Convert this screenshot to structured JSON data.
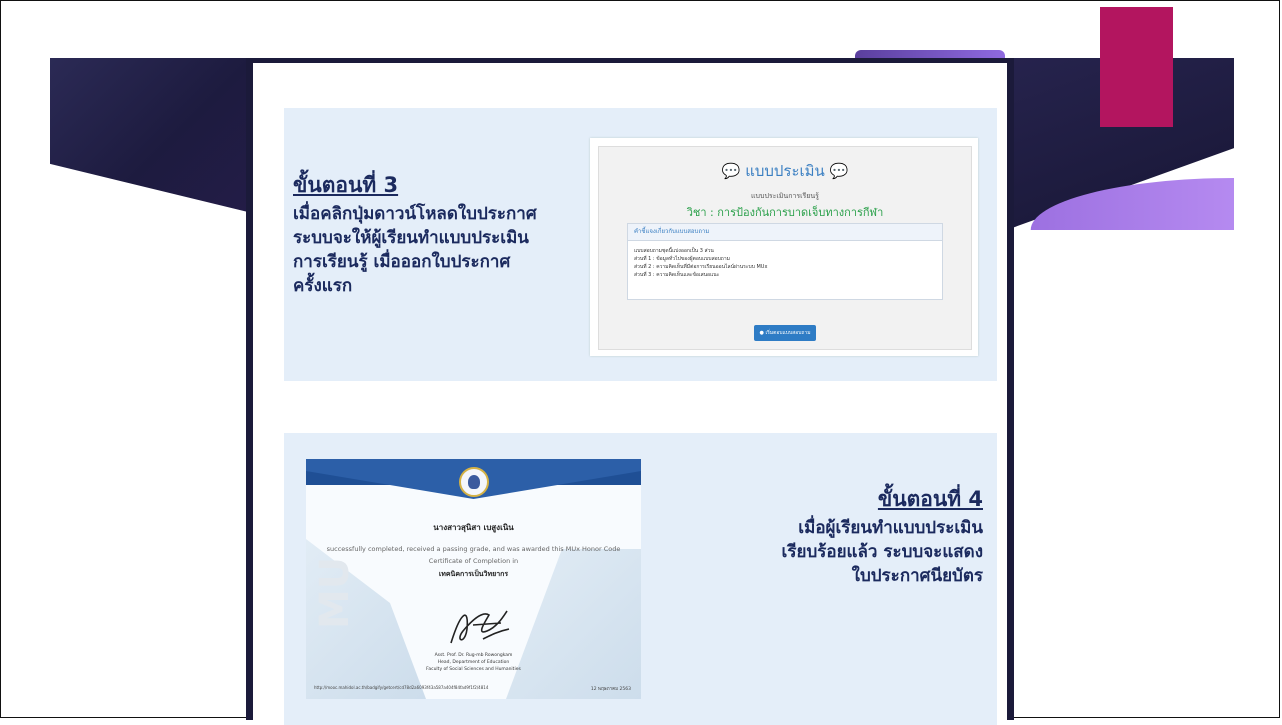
{
  "step3": {
    "title": "ขั้นตอนที่ 3",
    "lines": [
      "เมื่อคลิกปุ่มดาวน์โหลดใบประกาศ",
      "ระบบจะให้ผู้เรียนทำแบบประเมิน",
      "การเรียนรู้  เมื่อออกใบประกาศ",
      "ครั้งแรก"
    ]
  },
  "step4": {
    "title": "ขั้นตอนที่ 4",
    "lines": [
      "เมื่อผู้เรียนทำแบบประเมิน",
      "เรียบร้อยแล้ว ระบบจะแสดง",
      "ใบประกาศนียบัตร"
    ]
  },
  "evaluation": {
    "title": "แบบประเมิน",
    "subtitle": "แบบประเมินการเรียนรู้",
    "course": "วิชา : การป้องกันการบาดเจ็บทางการกีฬา",
    "box_header": "คำชี้แจงเกี่ยวกับแบบสอบถาม",
    "box_lines": [
      "แบบสอบถามชุดนี้แบ่งออกเป็น 3 ส่วน",
      "ส่วนที่ 1 : ข้อมูลทั่วไปของผู้ตอบแบบสอบถาม",
      "ส่วนที่ 2 : ความคิดเห็นที่มีต่อการเรียนออนไลน์ผ่านระบบ MUx",
      "ส่วนที่ 3 : ความคิดเห็นและข้อเสนอแนะ"
    ],
    "start_button": "เริ่มตอบแบบสอบถาม"
  },
  "certificate": {
    "name": "นางสาวสุนิสา เบสูงเนิน",
    "statement": "successfully completed, received a passing grade, and was awarded this MUx Honor Code",
    "cert_type": "Certificate of Completion in",
    "course": "เทคนิคการเป็นวิทยากร",
    "signer_name": "Asst. Prof. Dr. Rug-mb Rowongkam",
    "signer_title": "Head, Department of Education",
    "signer_faculty": "Faculty of Social Sciences and Humanities",
    "url": "http://mooc.mahidol.ac.th/badgify/getcert/cd78d2a6093f43a587a404f84fad9f1f2/4814",
    "date": "12 พฤษภาคม 2563",
    "watermark": "MU"
  },
  "colors": {
    "accent_pink": "#b3155f",
    "dark_navy": "#1b1a3a",
    "section_bg": "#e4eef9",
    "step_text": "#1b2a5e"
  }
}
